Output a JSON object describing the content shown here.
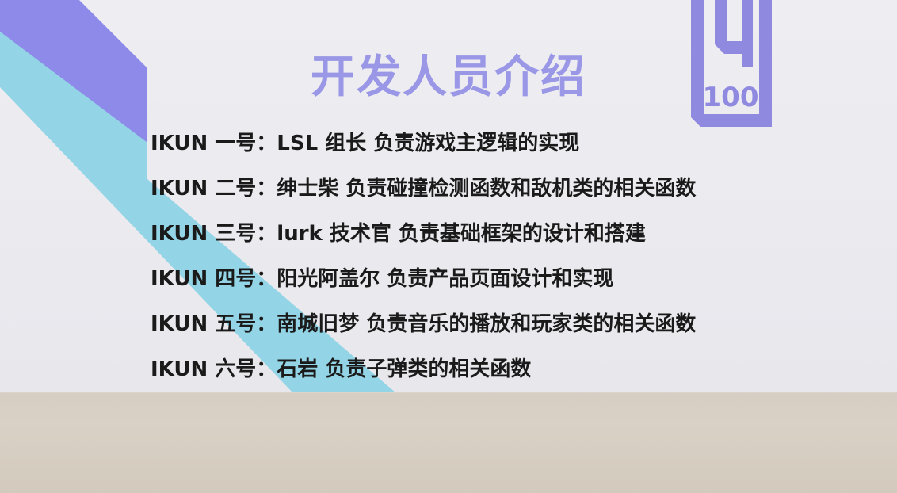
{
  "slide": {
    "title": "开发人员介绍",
    "members": [
      {
        "tag": "IKUN 一号：",
        "desc": "LSL 组长 负责游戏主逻辑的实现"
      },
      {
        "tag": "IKUN 二号：",
        "desc": "绅士柴 负责碰撞检测函数和敌机类的相关函数"
      },
      {
        "tag": "IKUN 三号：",
        "desc": "lurk 技术官 负责基础框架的设计和搭建"
      },
      {
        "tag": "IKUN 四号：",
        "desc": "阳光阿盖尔 负责产品页面设计和实现"
      },
      {
        "tag": "IKUN 五号：",
        "desc": "南城旧梦 负责音乐的播放和玩家类的相关函数"
      },
      {
        "tag": "IKUN 六号：",
        "desc": "石岩 负责子弹类的相关函数"
      }
    ],
    "logo": {
      "number": "100",
      "color": "#8f8ae0"
    },
    "colors": {
      "title": "#9a98e6",
      "stripe_purple": "#8a86e8",
      "stripe_teal": "#8fd3e3",
      "text": "#1a1a1a"
    }
  }
}
